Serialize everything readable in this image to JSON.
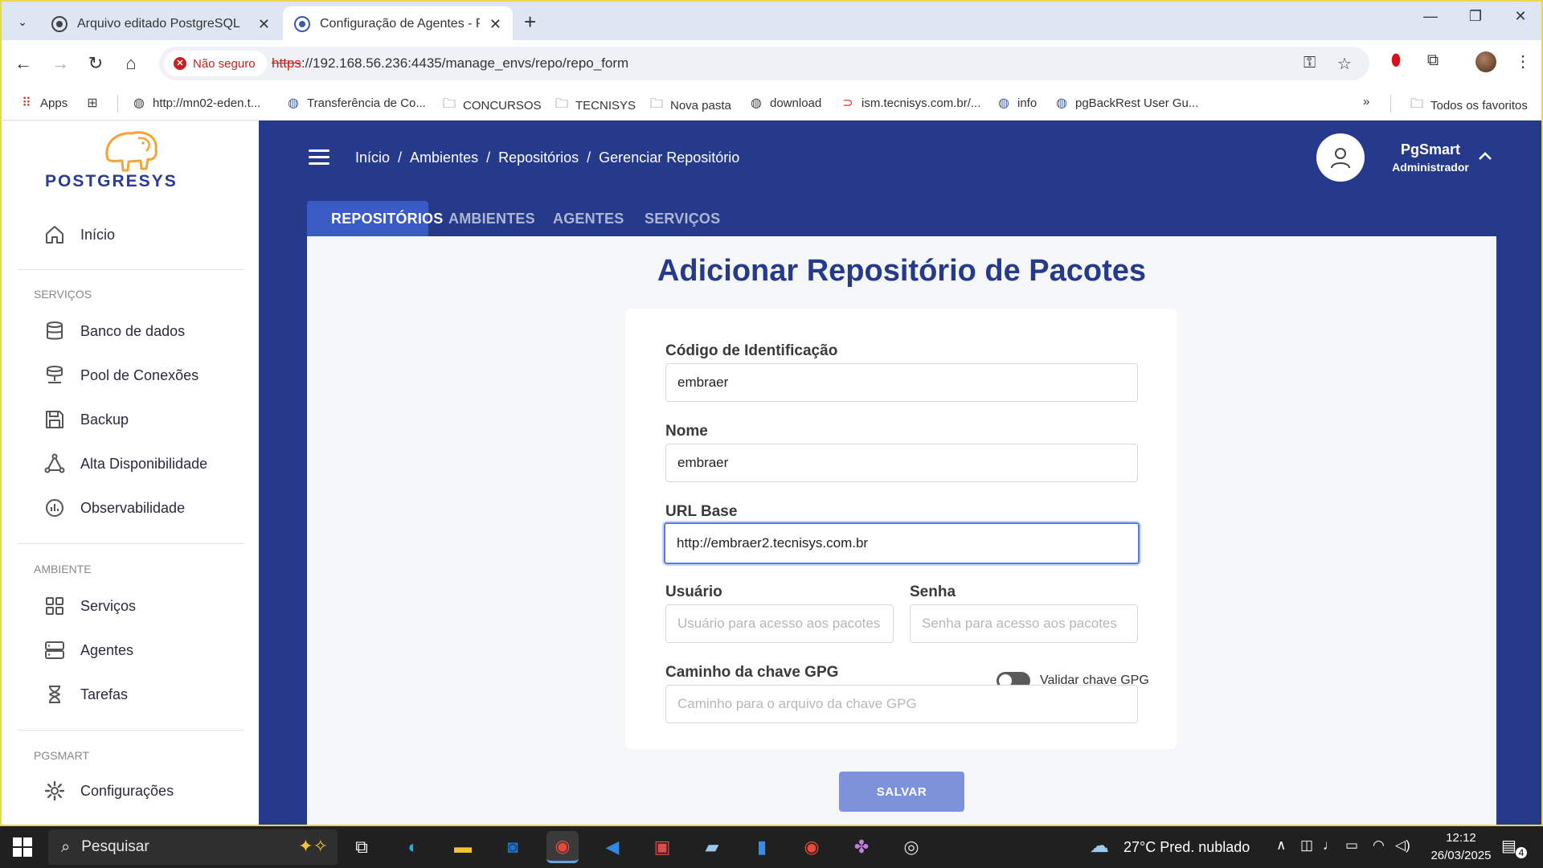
{
  "browser": {
    "tabs": [
      {
        "title": "Arquivo editado PostgreSQL",
        "active": false
      },
      {
        "title": "Configuração de Agentes - PgSmart",
        "active": true
      }
    ],
    "security_label": "Não seguro",
    "url_scheme": "https",
    "url_rest": "://192.168.56.236:4435/manage_envs/repo/repo_form",
    "bookmarks": [
      {
        "label": "Apps",
        "icon": "apps-grid-icon"
      },
      {
        "label": "http://mn02-eden.t...",
        "icon": "globe-icon"
      },
      {
        "label": "Transferência de Co...",
        "icon": "globe-icon"
      },
      {
        "label": "CONCURSOS",
        "icon": "folder-icon"
      },
      {
        "label": "TECNISYS",
        "icon": "folder-icon"
      },
      {
        "label": "Nova pasta",
        "icon": "folder-icon"
      },
      {
        "label": "download",
        "icon": "globe-icon"
      },
      {
        "label": "ism.tecnisys.com.br/...",
        "icon": "link-icon"
      },
      {
        "label": "info",
        "icon": "globe-icon"
      },
      {
        "label": "pgBackRest User Gu...",
        "icon": "globe-icon"
      }
    ],
    "all_bookmarks_label": "Todos os favoritos"
  },
  "sidebar": {
    "logo_text": "POSTGRESYS",
    "home_label": "Início",
    "sections": [
      {
        "title": "SERVIÇOS",
        "items": [
          "Banco de dados",
          "Pool de Conexões",
          "Backup",
          "Alta Disponibilidade",
          "Observabilidade"
        ]
      },
      {
        "title": "AMBIENTE",
        "items": [
          "Serviços",
          "Agentes",
          "Tarefas"
        ]
      },
      {
        "title": "PGSMART",
        "items": [
          "Configurações"
        ]
      }
    ]
  },
  "header": {
    "breadcrumb": [
      "Início",
      "Ambientes",
      "Repositórios",
      "Gerenciar Repositório"
    ],
    "breadcrumb_sep": "/",
    "user_name": "PgSmart",
    "user_role": "Administrador"
  },
  "tabs": [
    {
      "label": "REPOSITÓRIOS",
      "active": true
    },
    {
      "label": "AMBIENTES",
      "active": false
    },
    {
      "label": "AGENTES",
      "active": false
    },
    {
      "label": "SERVIÇOS",
      "active": false
    }
  ],
  "form": {
    "title": "Adicionar Repositório de Pacotes",
    "codigo_label": "Código de Identificação",
    "codigo_value": "embraer",
    "nome_label": "Nome",
    "nome_value": "embraer",
    "url_label": "URL Base",
    "url_value": "http://embraer2.tecnisys.com.br",
    "usuario_label": "Usuário",
    "usuario_placeholder": "Usuário para acesso aos pacotes",
    "senha_label": "Senha",
    "senha_placeholder": "Senha para acesso aos pacotes",
    "gpg_label": "Caminho da chave GPG",
    "gpg_placeholder": "Caminho para o arquivo da chave GPG",
    "validar_gpg_label": "Validar chave GPG",
    "validar_gpg_checked": false,
    "save_label": "SALVAR"
  },
  "taskbar": {
    "search_label": "Pesquisar",
    "weather": "27°C  Pred. nublado",
    "time": "12:12",
    "date": "26/03/2025",
    "notification_count": "4"
  },
  "colors": {
    "primary": "#253a8a",
    "tab_active": "#3b5bc4",
    "button": "#7e92da",
    "title": "#253a8a"
  }
}
